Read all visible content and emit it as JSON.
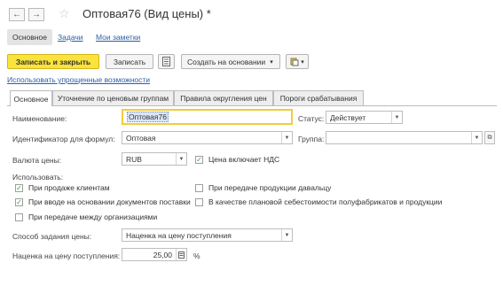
{
  "window": {
    "title": "Оптовая76 (Вид цены) *"
  },
  "page_tabs": [
    {
      "label": "Основное"
    },
    {
      "label": "Задачи"
    },
    {
      "label": "Мои заметки"
    }
  ],
  "toolbar": {
    "save_close_label": "Записать и закрыть",
    "save_label": "Записать",
    "create_based_label": "Создать на основании",
    "chevron": "▾"
  },
  "simplified_link": "Использовать упрощенные возможности",
  "tabs": [
    {
      "label": "Основное"
    },
    {
      "label": "Уточнение по ценовым группам"
    },
    {
      "label": "Правила округления цен"
    },
    {
      "label": "Пороги срабатывания"
    }
  ],
  "form": {
    "name_label": "Наименование:",
    "name_value": "Оптовая76",
    "status_label": "Статус:",
    "status_value": "Действует",
    "id_label": "Идентификатор для формул:",
    "id_value": "Оптовая",
    "group_label": "Группа:",
    "group_value": "",
    "currency_label": "Валюта цены:",
    "currency_value": "RUB",
    "vat_label": "Цена включает НДС",
    "use_label": "Использовать:",
    "checkboxes": [
      {
        "label": "При продаже клиентам",
        "checked": true
      },
      {
        "label": "При передаче продукции давальцу",
        "checked": false
      },
      {
        "label": "При вводе на основании документов поставки",
        "checked": true
      },
      {
        "label": "В качестве плановой себестоимости полуфабрикатов и продукции",
        "checked": false
      },
      {
        "label": "При передаче между организациями",
        "checked": false
      }
    ],
    "method_label": "Способ задания цены:",
    "method_value": "Наценка на цену поступления",
    "markup_label": "Наценка на цену поступления:",
    "markup_value": "25,00",
    "percent": "%"
  },
  "icons": {
    "back": "🡐",
    "forward": "🡒",
    "star": "☆",
    "check": "✓",
    "dropdown": "▼",
    "ellipsis": "···"
  },
  "colors": {
    "primary_button": "#f9e33c",
    "link": "#2b5ea8",
    "focus_border": "#f2cc3a",
    "check": "#3a9b3a"
  }
}
